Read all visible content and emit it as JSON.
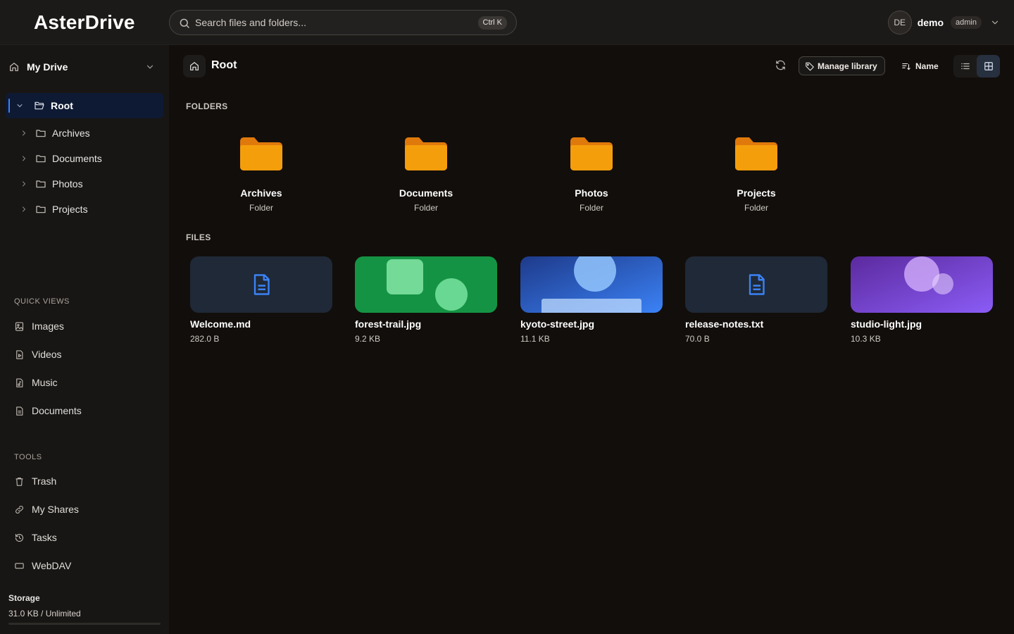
{
  "app": {
    "title": "AsterDrive"
  },
  "search": {
    "placeholder": "Search files and folders...",
    "shortcut": "Ctrl K"
  },
  "user": {
    "initials": "DE",
    "name": "demo",
    "role": "admin"
  },
  "sidebar": {
    "drive_label": "My Drive",
    "tree": {
      "root": "Root",
      "children": [
        "Archives",
        "Documents",
        "Photos",
        "Projects"
      ]
    },
    "quick_views_title": "QUICK VIEWS",
    "quick_views": [
      {
        "label": "Images",
        "icon": "image-icon"
      },
      {
        "label": "Videos",
        "icon": "video-icon"
      },
      {
        "label": "Music",
        "icon": "music-icon"
      },
      {
        "label": "Documents",
        "icon": "document-icon"
      }
    ],
    "tools_title": "TOOLS",
    "tools": [
      {
        "label": "Trash",
        "icon": "trash-icon"
      },
      {
        "label": "My Shares",
        "icon": "link-icon"
      },
      {
        "label": "Tasks",
        "icon": "history-icon"
      },
      {
        "label": "WebDAV",
        "icon": "monitor-icon"
      }
    ],
    "storage": {
      "title": "Storage",
      "value": "31.0 KB / Unlimited",
      "fill_fraction": 0
    }
  },
  "toolbar": {
    "breadcrumb": "Root",
    "manage_label": "Manage library",
    "sort_label": "Name",
    "view_mode": "grid"
  },
  "folders_title": "FOLDERS",
  "folders": [
    {
      "name": "Archives",
      "type": "Folder"
    },
    {
      "name": "Documents",
      "type": "Folder"
    },
    {
      "name": "Photos",
      "type": "Folder"
    },
    {
      "name": "Projects",
      "type": "Folder"
    }
  ],
  "files_title": "FILES",
  "files": [
    {
      "name": "Welcome.md",
      "size": "282.0 B",
      "thumb": "document"
    },
    {
      "name": "forest-trail.jpg",
      "size": "9.2 KB",
      "thumb": "green-image"
    },
    {
      "name": "kyoto-street.jpg",
      "size": "11.1 KB",
      "thumb": "blue-image"
    },
    {
      "name": "release-notes.txt",
      "size": "70.0 B",
      "thumb": "document"
    },
    {
      "name": "studio-light.jpg",
      "size": "10.3 KB",
      "thumb": "purple-image"
    }
  ],
  "colors": {
    "accent": "#3b82f6",
    "folder": "#f59e0b",
    "background": "#120e0b",
    "sidebar": "#181614"
  }
}
